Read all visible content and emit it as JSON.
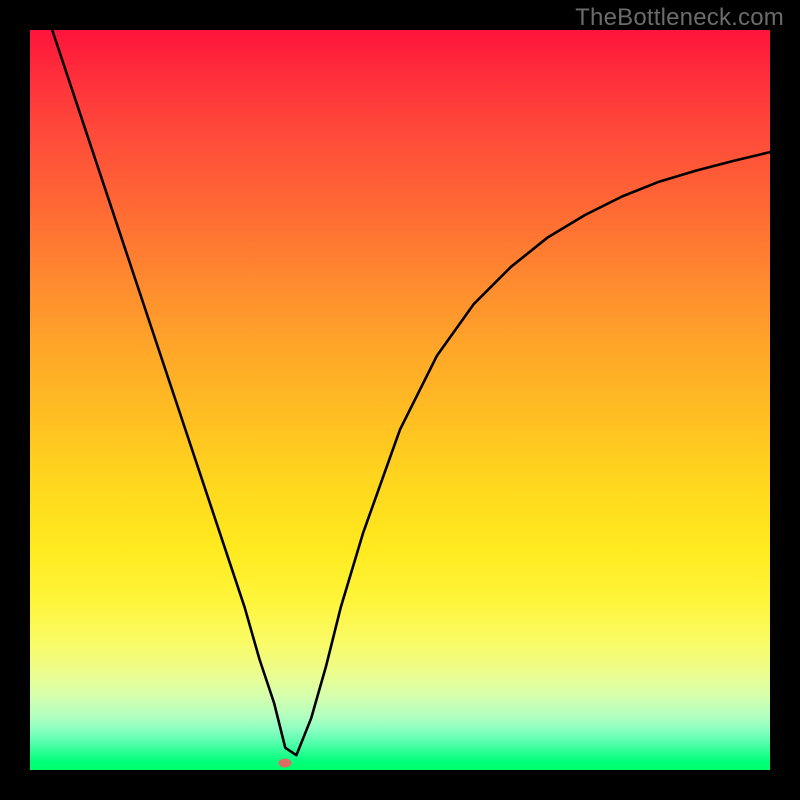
{
  "watermark": "TheBottleneck.com",
  "gradient": {
    "top_color": "#ff143b",
    "bottom_color": "#00ff6a"
  },
  "chart_data": {
    "type": "line",
    "title": "",
    "xlabel": "",
    "ylabel": "",
    "xlim": [
      0,
      100
    ],
    "ylim": [
      0,
      100
    ],
    "grid": false,
    "legend": false,
    "series": [
      {
        "name": "curve",
        "color": "#000000",
        "x": [
          3,
          5,
          8,
          12,
          16,
          20,
          24,
          27,
          29,
          31,
          33,
          34.5,
          36,
          38,
          40,
          42,
          45,
          50,
          55,
          60,
          65,
          70,
          75,
          80,
          85,
          90,
          95,
          100
        ],
        "y": [
          100,
          94,
          85,
          73,
          61,
          49,
          37,
          28,
          22,
          15,
          9,
          3,
          2,
          7,
          14,
          22,
          32,
          46,
          56,
          63,
          68,
          72,
          75,
          77.5,
          79.5,
          81,
          82.3,
          83.5
        ]
      }
    ],
    "marker": {
      "series": "curve",
      "x": 34.5,
      "y": 1,
      "color": "#de6d64"
    }
  }
}
